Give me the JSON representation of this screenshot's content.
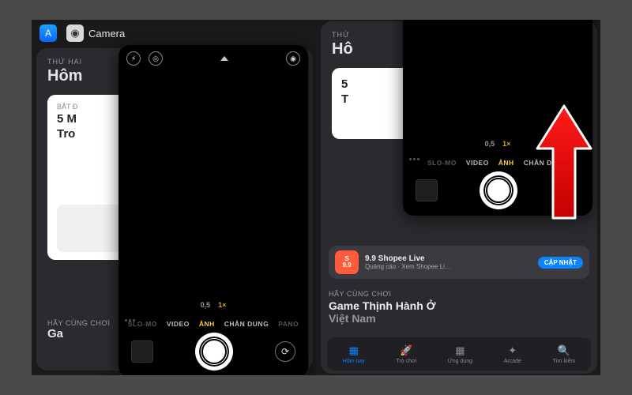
{
  "left": {
    "switcher": {
      "appstore_icon_glyph": "A",
      "camera_icon_glyph": "◉",
      "camera_label": "Camera"
    },
    "background": {
      "day": "THỨ HAI",
      "heading": "Hôm",
      "preview_kicker": "BẮT Đ",
      "preview_title_l1": "5 M",
      "preview_title_l2": "Tro",
      "footer_kicker": "HÃY CÙNG CHƠI",
      "footer_title": "Ga"
    },
    "camera": {
      "flash_glyph": "⚡︎",
      "live_glyph": "◎",
      "filters_glyph": "◉",
      "zoom_a": "0,5",
      "zoom_b": "1×",
      "modes": {
        "m1": "SLO-MO",
        "m2": "VIDEO",
        "m3": "ẢNH",
        "m4": "CHÂN DUNG",
        "m5": "PANO"
      },
      "flip_glyph": "⟳"
    }
  },
  "right": {
    "background": {
      "day": "THỨ",
      "heading": "Hô",
      "preview_title_l1": "5",
      "preview_title_l2": "T",
      "shopee_line1a": "S",
      "shopee_line1b": "9.9",
      "shopee_title": "9.9 Shopee Live",
      "shopee_sub": "Quảng cáo · Xem Shopee Li…",
      "shopee_cta": "CẬP NHẬT",
      "section_kicker": "HÃY CÙNG CHƠI",
      "section_title_l1": "Game Thịnh Hành Ở",
      "section_title_l2": "Việt Nam"
    },
    "camera": {
      "zoom_a": "0,5",
      "zoom_b": "1×",
      "modes": {
        "m1": "SLO-MO",
        "m2": "VIDEO",
        "m3": "ẢNH",
        "m4": "CHÂN DUNG"
      }
    },
    "tabs": {
      "t1": "Hôm nay",
      "t2": "Trò chơi",
      "t3": "Ứng dụng",
      "t4": "Arcade",
      "t5": "Tìm kiếm",
      "i1": "▦",
      "i2": "🚀",
      "i3": "▦",
      "i4": "✦",
      "i5": "🔍"
    }
  }
}
